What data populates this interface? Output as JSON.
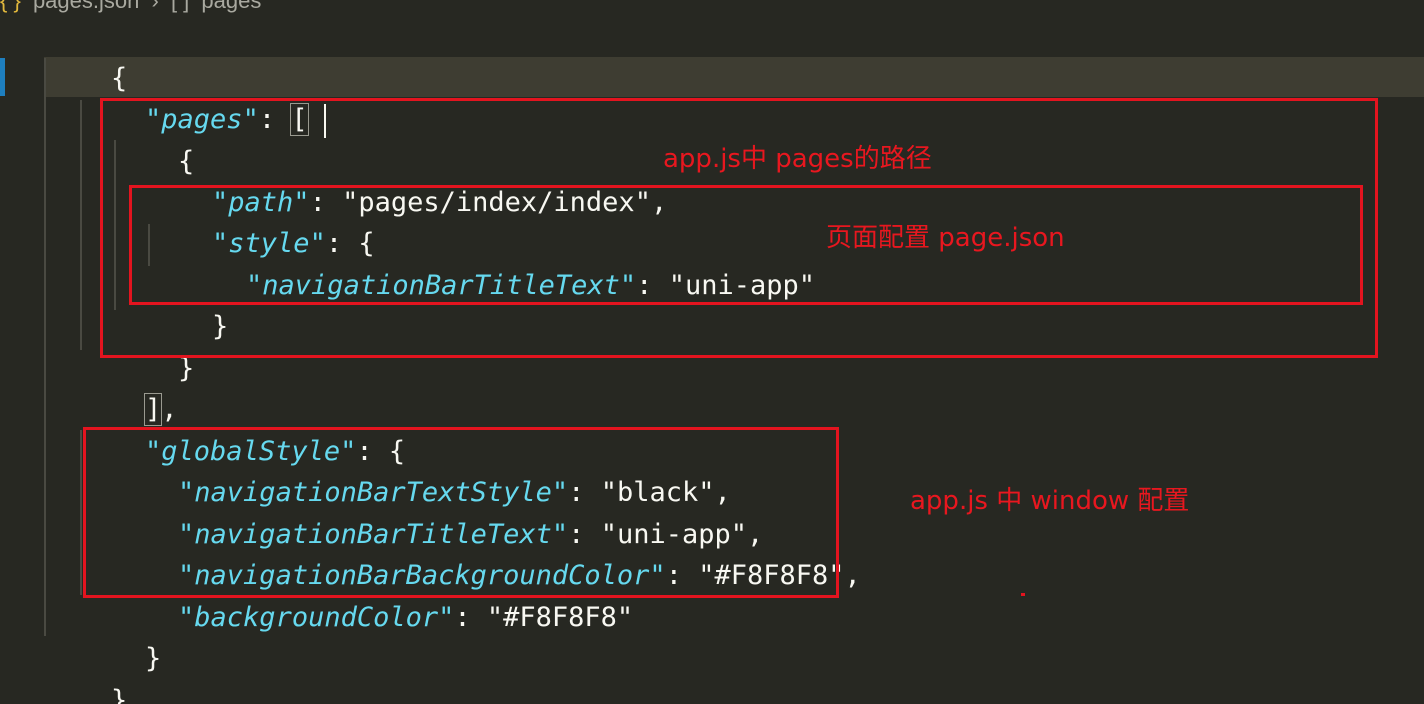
{
  "breadcrumb": {
    "icon": "json-braces-icon",
    "file": "pages.json",
    "separator": "›",
    "node_icon": "[ ]",
    "node": "pages"
  },
  "code": {
    "open_root": "{",
    "pages_key": "\"pages\"",
    "colon": ": ",
    "open_array": "[",
    "open_obj": "{",
    "path_key": "\"path\"",
    "path_value": "\"pages/index/index\"",
    "comma": ",",
    "style_key": "\"style\"",
    "open_style": "{",
    "nav_title_key": "\"navigationBarTitleText\"",
    "nav_title_value": "\"uni-app\"",
    "close_style": "}",
    "close_obj": "}",
    "close_array": "]",
    "global_key": "\"globalStyle\"",
    "open_global": "{",
    "g_text_style_key": "\"navigationBarTextStyle\"",
    "g_text_style_value": "\"black\"",
    "g_title_key": "\"navigationBarTitleText\"",
    "g_title_value": "\"uni-app\"",
    "g_bg_key": "\"navigationBarBackgroundColor\"",
    "g_bg_value": "\"#F8F8F8\"",
    "g_bgcolor_key": "\"backgroundColor\"",
    "g_bgcolor_value": "\"#F8F8F8\"",
    "close_global": "}",
    "close_root": "}"
  },
  "annotations": {
    "pages_note": "app.js中 pages的路径",
    "style_note": "页面配置 page.json",
    "window_note": "app.js 中 window 配置"
  },
  "colors": {
    "background": "#272822",
    "key": "#66d9ef",
    "text": "#f8f8f2",
    "annotation": "#e3141f"
  }
}
